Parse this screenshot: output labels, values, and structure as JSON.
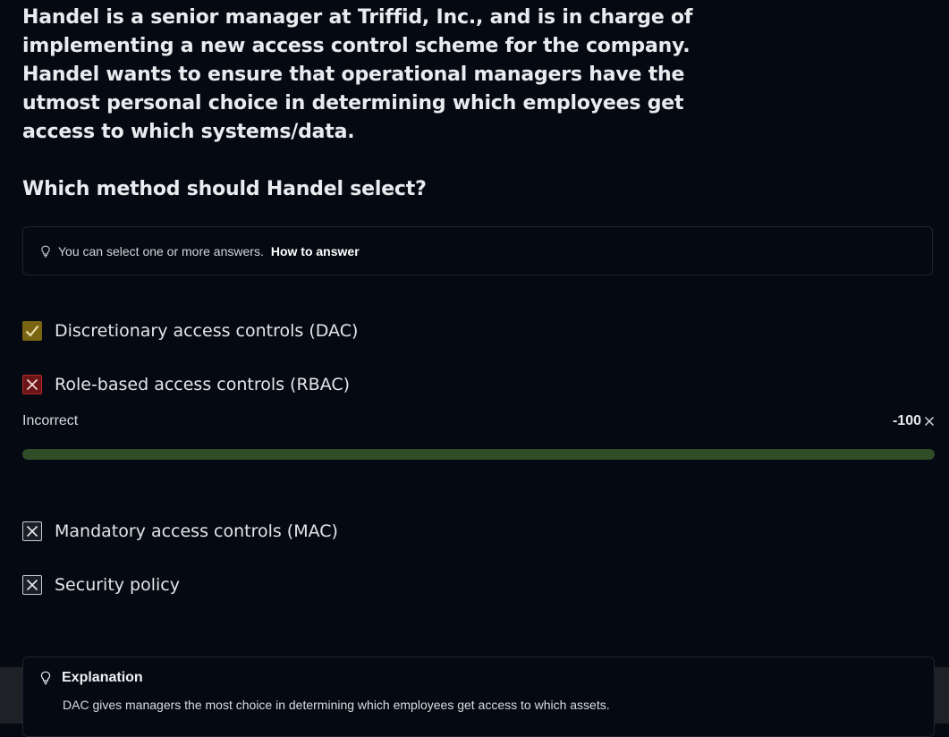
{
  "question": {
    "text": "Handel is a senior manager at Triffid, Inc., and is in charge of implementing a new access control scheme for the company. Handel wants to ensure that operational managers have the utmost personal choice in determining which employees get access to which systems/data.",
    "prompt": "Which method should Handel select?"
  },
  "hint": {
    "icon": "lightbulb-icon",
    "text": "You can select one or more answers.",
    "link": "How to answer"
  },
  "options": [
    {
      "label": "Discretionary access controls (DAC)",
      "state": "correct",
      "icon": "checkmark-icon"
    },
    {
      "label": "Role-based access controls (RBAC)",
      "state": "incorrect-selected",
      "icon": "x-icon"
    },
    {
      "label": "Mandatory access controls (MAC)",
      "state": "unselected",
      "icon": "x-icon"
    },
    {
      "label": "Security policy",
      "state": "unselected",
      "icon": "x-icon"
    }
  ],
  "feedback": {
    "status": "Incorrect",
    "score": "-100",
    "progress": 1.0
  },
  "explanation": {
    "title": "Explanation",
    "text": "DAC gives managers the most choice in determining which employees get access to which assets."
  },
  "colors": {
    "background": "#050a12",
    "correct": "#7a6512",
    "incorrect": "#6b1517",
    "progress": "#2f4d27"
  }
}
